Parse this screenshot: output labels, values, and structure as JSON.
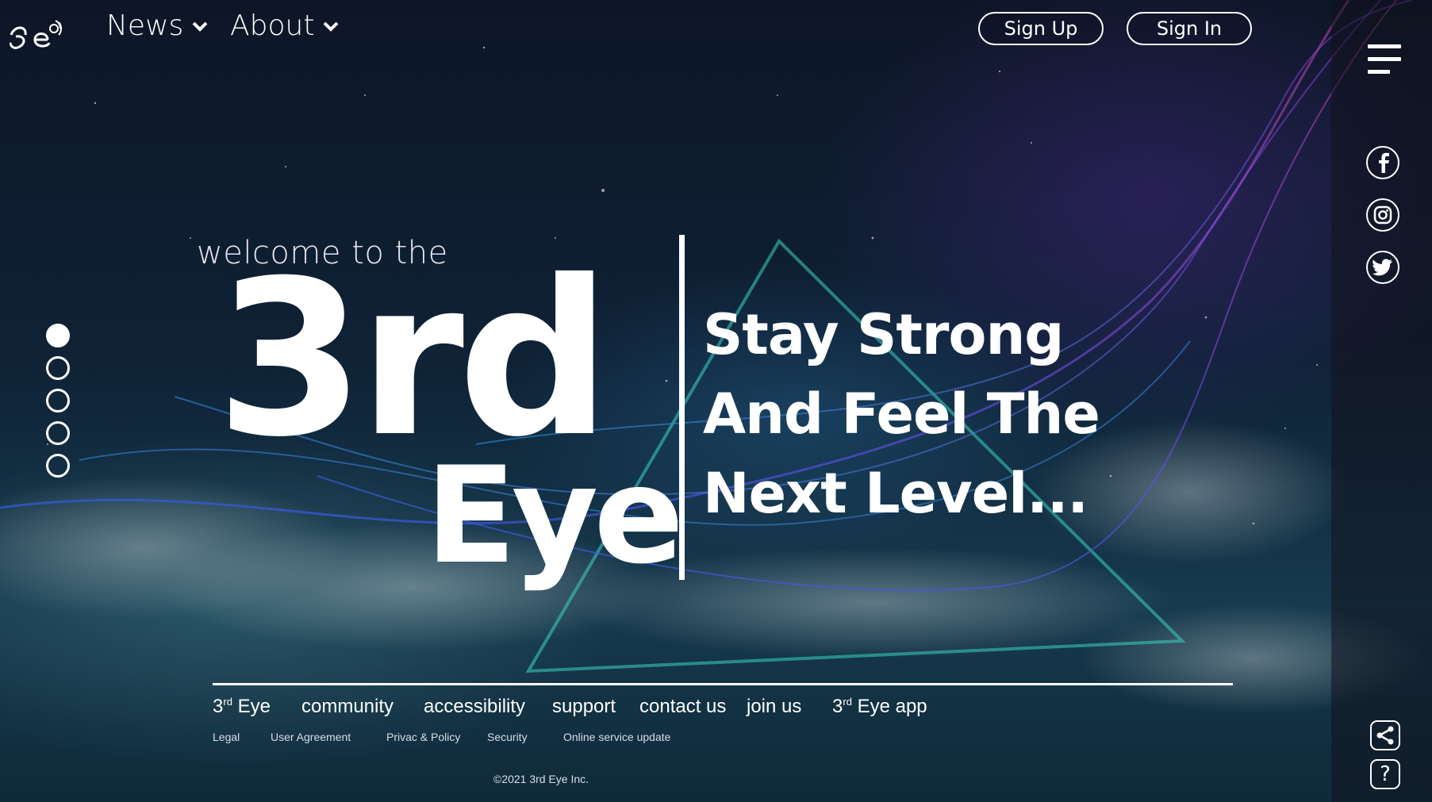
{
  "header": {
    "nav": [
      {
        "label": "News"
      },
      {
        "label": "About"
      }
    ],
    "sign_up": "Sign Up",
    "sign_in": "Sign In"
  },
  "hero": {
    "welcome": "welcome to the",
    "brand_line1": "3rd",
    "brand_line2": "Eye",
    "tagline": [
      "Stay Strong",
      "And Feel The",
      "Next Level..."
    ]
  },
  "slides": {
    "count": 5,
    "active_index": 0
  },
  "social": [
    "facebook",
    "instagram",
    "twitter"
  ],
  "footer": {
    "links": [
      {
        "base": "3",
        "sup": "rd",
        "rest": " Eye"
      },
      {
        "base": "community",
        "sup": "",
        "rest": ""
      },
      {
        "base": "accessibility",
        "sup": "",
        "rest": ""
      },
      {
        "base": "support",
        "sup": "",
        "rest": ""
      },
      {
        "base": "contact us",
        "sup": "",
        "rest": ""
      },
      {
        "base": "join us",
        "sup": "",
        "rest": ""
      },
      {
        "base": "3",
        "sup": "rd",
        "rest": " Eye app"
      }
    ],
    "sub_links": [
      "Legal",
      "User Agreement",
      "Privac & Policy",
      "Security",
      "Online service update"
    ],
    "copyright": "©2021 3rd Eye Inc."
  },
  "colors": {
    "accent_purple": "#8a3bd6",
    "accent_teal": "#3ad1c0",
    "accent_blue": "#3b6ee8"
  }
}
